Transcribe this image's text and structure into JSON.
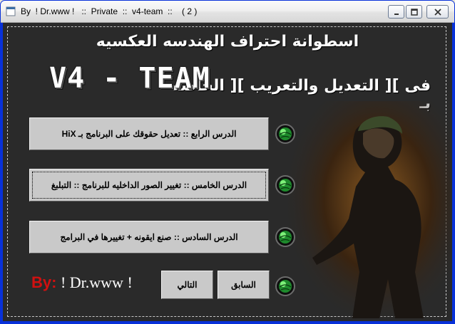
{
  "window": {
    "title": "By  ! Dr.www !   ::  Private  ::  v4-team  ::    ( 2 )",
    "controls": [
      "minimize",
      "maximize",
      "close"
    ]
  },
  "header": {
    "line1": "اسطوانة احتراف الهندسه العكسيه",
    "line2_arabic": "فى ][ التعديل والتعريب ][ الخاصه بـ",
    "team_logo": "V4 - TEAM"
  },
  "lessons": [
    {
      "label": "الدرس الرابع  ::  تعديل حقوقك على البرنامج بـ  HiX"
    },
    {
      "label": "الدرس الخامس :: تغيير الصور الداخليه للبرنامج :: التبلبغ"
    },
    {
      "label": "الدرس السادس :: صنع ايقونه + تغييرها في البرامج"
    }
  ],
  "navigation": {
    "previous_label": "السابق",
    "next_label": "التالي"
  },
  "credit": {
    "by": "By:",
    "name": " ! Dr.www ! "
  },
  "colors": {
    "background": "#2a2a2a",
    "button_face": "#c9c9c9",
    "credit_by": "#d01010",
    "orb_green": "#2fd23f"
  },
  "icons": {
    "orb": "green-globe-icon",
    "art": "joker-figure-illustration"
  }
}
